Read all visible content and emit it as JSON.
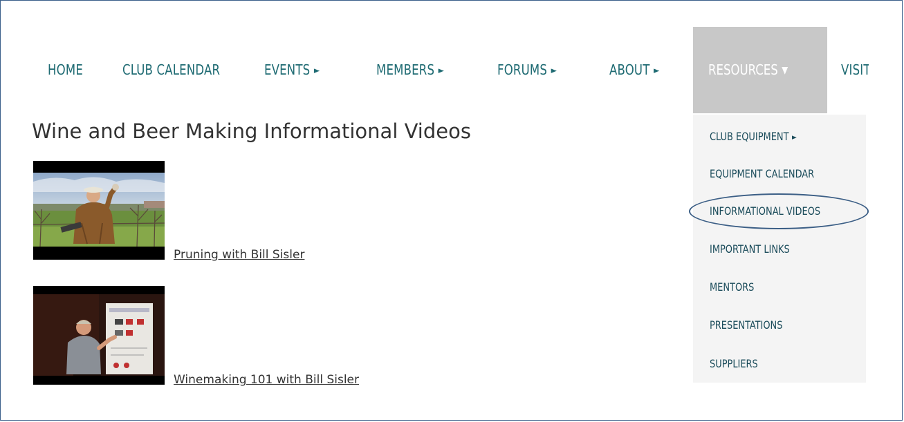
{
  "nav": {
    "items": [
      {
        "label": "HOME",
        "arrow": ""
      },
      {
        "label": "CLUB CALENDAR",
        "arrow": ""
      },
      {
        "label": "EVENTS",
        "arrow": "►"
      },
      {
        "label": "MEMBERS",
        "arrow": "►"
      },
      {
        "label": "FORUMS",
        "arrow": "►"
      },
      {
        "label": "ABOUT",
        "arrow": "►"
      }
    ],
    "active": {
      "label": "RESOURCES",
      "arrow": "▼"
    },
    "clipped": {
      "label": "VISITORS"
    }
  },
  "dropdown": {
    "items": [
      {
        "label": "CLUB EQUIPMENT",
        "arrow": "►"
      },
      {
        "label": "EQUIPMENT CALENDAR",
        "arrow": ""
      },
      {
        "label": "INFORMATIONAL VIDEOS",
        "arrow": ""
      },
      {
        "label": "IMPORTANT LINKS",
        "arrow": ""
      },
      {
        "label": "MENTORS",
        "arrow": ""
      },
      {
        "label": "PRESENTATIONS",
        "arrow": ""
      },
      {
        "label": "SUPPLIERS",
        "arrow": ""
      }
    ]
  },
  "page": {
    "title": "Wine and Beer Making Informational Videos"
  },
  "videos": [
    {
      "title": "Pruning with Bill Sisler"
    },
    {
      "title": "Winemaking 101 with Bill Sisler"
    }
  ],
  "colors": {
    "nav_text": "#1f6b73",
    "active_bg": "#c8c8c8",
    "dropdown_bg": "#f4f4f4",
    "annotation_oval": "#3c5f86"
  }
}
